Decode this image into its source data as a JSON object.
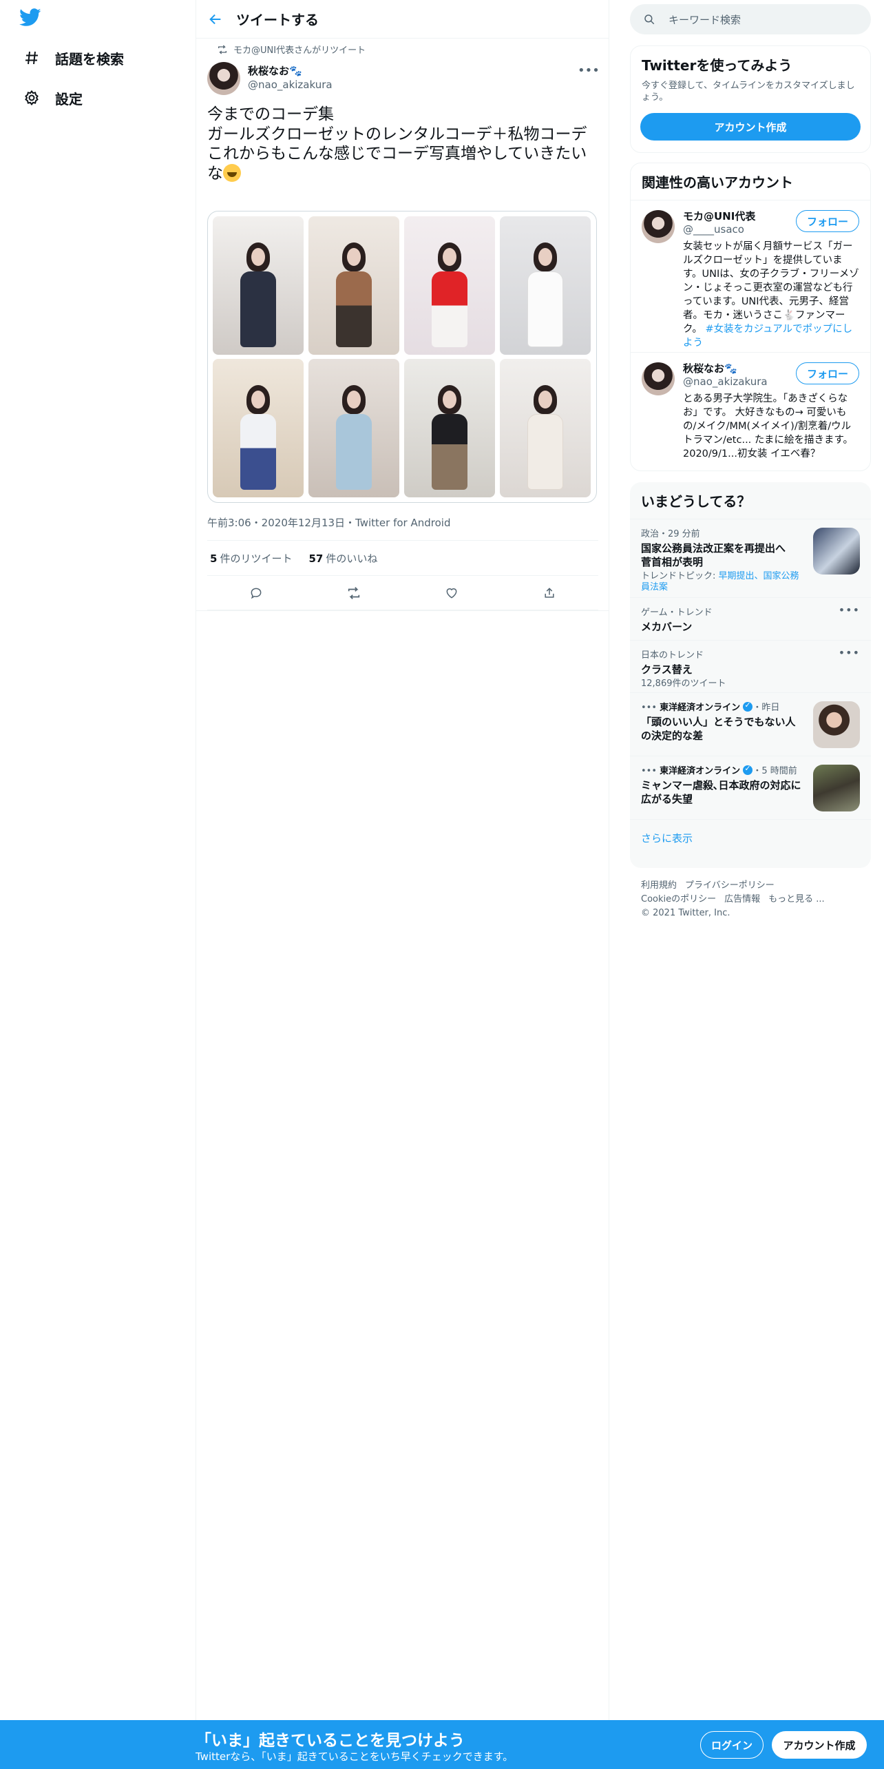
{
  "nav": {
    "items": [
      {
        "label": "話題を検索",
        "icon": "hashtag-icon"
      },
      {
        "label": "設定",
        "icon": "gear-icon"
      }
    ]
  },
  "header": {
    "title": "ツイートする"
  },
  "tweet": {
    "retweeted_by": "モカ@UNI代表さんがリツイート",
    "author_name": "秋桜なお🐾",
    "author_handle": "@nao_akizakura",
    "text": "今までのコーデ集\nガールズクローゼットのレンタルコーデ＋私物コーデ\nこれからもこんな感じでコーデ写真増やしていきたいな",
    "media_count": 8,
    "meta": "午前3:06・2020年12月13日・Twitter for Android",
    "retweets_count": "5",
    "retweets_label": "件のリツイート",
    "likes_count": "57",
    "likes_label": "件のいいね"
  },
  "search": {
    "placeholder": "キーワード検索"
  },
  "signup_card": {
    "title": "Twitterを使ってみよう",
    "subtitle": "今すぐ登録して、タイムラインをカスタマイズしましょう。",
    "button": "アカウント作成"
  },
  "related": {
    "title": "関連性の高いアカウント",
    "follow_label": "フォロー",
    "accounts": [
      {
        "name": "モカ@UNI代表",
        "handle": "@____usaco",
        "bio": "女装セットが届く月額サービス「ガールズクローゼット」を提供しています。UNIは、女の子クラブ・フリーメゾン・じょそっこ更衣室の運営なども行っています。UNI代表、元男子、経営者。モカ・迷いうさこ🐇ファンマーク。",
        "bio_tag": "#女装をカジュアルでポップにしよう"
      },
      {
        "name": "秋桜なお🐾",
        "handle": "@nao_akizakura",
        "bio": "とある男子大学院生。「あきざくらなお」です。 大好きなもの→ 可愛いもの/メイク/MM(メイメイ)/割烹着/ウルトラマン/etc... たまに絵を描きます。 2020/9/1...初女装 イエベ春？",
        "bio_tag": ""
      }
    ]
  },
  "trends": {
    "title": "いまどうしてる？",
    "items": [
      {
        "context": "政治・29 分前",
        "title": "国家公務員法改正案を再提出へ 菅首相が表明",
        "sub_prefix": "トレンドトピック: ",
        "sub_link": "早期提出、国家公務員法案",
        "has_image": true
      },
      {
        "context": "ゲーム・トレンド",
        "title": "メカバーン",
        "sub_prefix": "",
        "sub_link": "",
        "has_image": false
      },
      {
        "context": "日本のトレンド",
        "title": "クラス替え",
        "sub_prefix": "12,869件のツイート",
        "sub_link": "",
        "has_image": false
      },
      {
        "context": "東洋経済オンライン",
        "context_time": "・昨日",
        "title": "「頭のいい人」とそうでもない人の決定的な差",
        "has_image": true
      },
      {
        "context": "東洋経済オンライン",
        "context_time": "・5 時間前",
        "title": "ミャンマー虐殺､日本政府の対応に広がる失望",
        "has_image": true
      }
    ],
    "show_more": "さらに表示"
  },
  "footer": {
    "links_row1": [
      "利用規約",
      "プライバシーポリシー"
    ],
    "links_row2": [
      "Cookieのポリシー",
      "広告情報",
      "もっと見る ..."
    ],
    "copyright": "© 2021 Twitter, Inc."
  },
  "bottom_bar": {
    "title": "「いま」起きていることを見つけよう",
    "subtitle": "Twitterなら、「いま」起きていることをいち早くチェックできます。",
    "login": "ログイン",
    "signup": "アカウント作成"
  },
  "colors": {
    "accent": "#1d9bf0",
    "text": "#0f1419",
    "muted": "#536471",
    "border": "#eff3f4"
  }
}
